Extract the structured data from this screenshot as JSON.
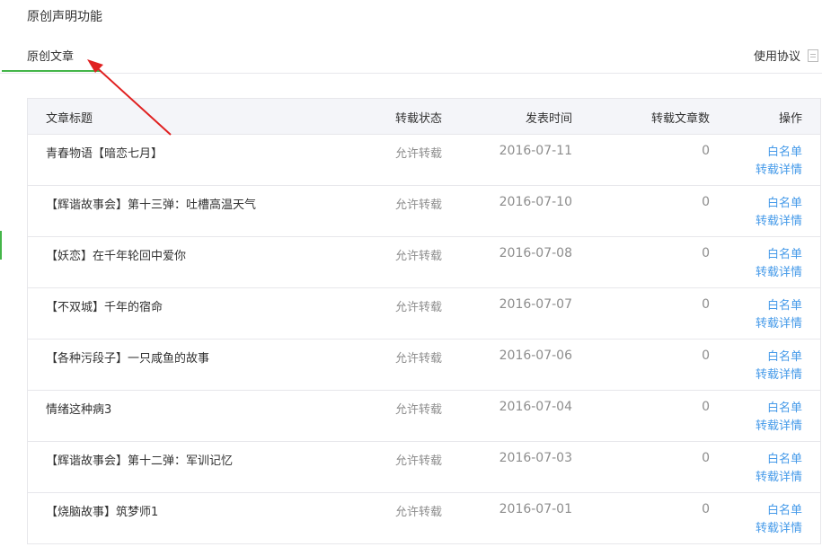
{
  "header": {
    "title": "原创声明功能"
  },
  "tabs": [
    {
      "label": "原创文章",
      "active": true
    }
  ],
  "agreement": {
    "label": "使用协议"
  },
  "table": {
    "columns": [
      "文章标题",
      "转载状态",
      "发表时间",
      "转载文章数",
      "操作"
    ],
    "rows": [
      {
        "title": "青春物语【暗恋七月】",
        "status": "允许转载",
        "date": "2016-07-11",
        "count": "0",
        "action1": "白名单",
        "action2": "转载详情"
      },
      {
        "title": "【辉谐故事会】第十三弹：吐槽高温天气",
        "status": "允许转载",
        "date": "2016-07-10",
        "count": "0",
        "action1": "白名单",
        "action2": "转载详情"
      },
      {
        "title": "【妖恋】在千年轮回中爱你",
        "status": "允许转载",
        "date": "2016-07-08",
        "count": "0",
        "action1": "白名单",
        "action2": "转载详情"
      },
      {
        "title": "【不双城】千年的宿命",
        "status": "允许转载",
        "date": "2016-07-07",
        "count": "0",
        "action1": "白名单",
        "action2": "转载详情"
      },
      {
        "title": "【各种污段子】一只咸鱼的故事",
        "status": "允许转载",
        "date": "2016-07-06",
        "count": "0",
        "action1": "白名单",
        "action2": "转载详情"
      },
      {
        "title": "情绪这种病3",
        "status": "允许转载",
        "date": "2016-07-04",
        "count": "0",
        "action1": "白名单",
        "action2": "转载详情"
      },
      {
        "title": "【辉谐故事会】第十二弹：军训记忆",
        "status": "允许转载",
        "date": "2016-07-03",
        "count": "0",
        "action1": "白名单",
        "action2": "转载详情"
      },
      {
        "title": "【烧脑故事】筑梦师1",
        "status": "允许转载",
        "date": "2016-07-01",
        "count": "0",
        "action1": "白名单",
        "action2": "转载详情"
      }
    ]
  },
  "colors": {
    "accent_green": "#44b549",
    "link_blue": "#459ae9",
    "arrow_red": "#e02020"
  }
}
